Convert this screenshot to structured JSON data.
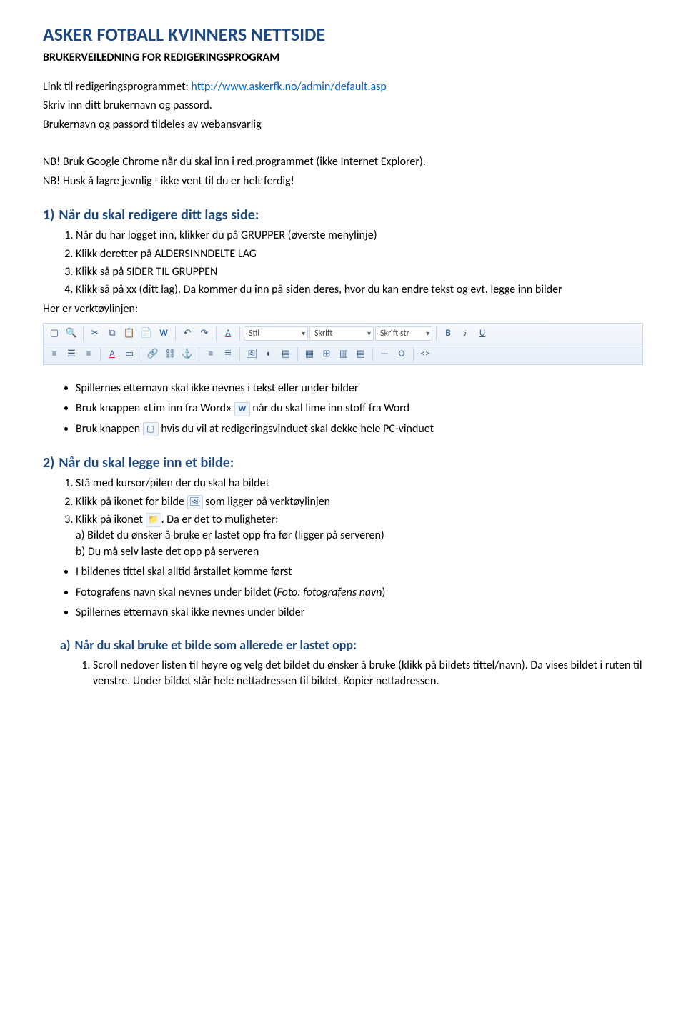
{
  "title": "ASKER FOTBALL KVINNERS NETTSIDE",
  "subtitle": "BRUKERVEILEDNING FOR REDIGERINGSPROGRAM",
  "intro": {
    "line1_prefix": "Link til redigeringsprogrammet: ",
    "link_text": "http://www.askerfk.no/admin/default.asp",
    "line2": "Skriv inn ditt brukernavn og passord.",
    "line3": "Brukernavn og passord tildeles av webansvarlig",
    "nb1": "NB! Bruk Google Chrome når du skal inn i red.programmet (ikke Internet Explorer).",
    "nb2": "NB! Husk å lagre jevnlig - ikke vent til du er helt ferdig!"
  },
  "section1": {
    "num": "1)",
    "title": "Når du skal redigere ditt lags side:",
    "items": [
      "Når du har logget inn, klikker du på GRUPPER (øverste menylinje)",
      "Klikk deretter på ALDERSINNDELTE LAG",
      "Klikk så på SIDER TIL GRUPPEN",
      "Klikk så på xx (ditt lag). Da kommer du inn på siden deres, hvor du kan endre tekst og evt. legge inn bilder"
    ],
    "toolbar_label": "Her er verktøylinjen:"
  },
  "toolbar": {
    "style_dd": "Stil",
    "font_dd": "Skrift",
    "fontsize_dd": "Skrift str"
  },
  "bullets1": {
    "b1": "Spillernes etternavn skal ikke nevnes i tekst eller under bilder",
    "b2_before": "Bruk knappen «Lim inn fra Word» ",
    "b2_after": " når du skal lime inn stoff fra Word",
    "b3_before": "Bruk knappen ",
    "b3_after": " hvis du vil at redigeringsvinduet skal dekke hele PC-vinduet"
  },
  "section2": {
    "num": "2)",
    "title": "Når du skal legge inn et bilde:",
    "i1": "Stå med kursor/pilen der du skal ha bildet",
    "i2_before": "Klikk på ikonet for bilde ",
    "i2_after": " som ligger på verktøylinjen",
    "i3_before": "Klikk på ikonet ",
    "i3_after": ". Da er det to muligheter:",
    "i3a": "a) Bildet du ønsker å bruke er lastet opp fra før (ligger på serveren)",
    "i3b": "b) Du må selv laste det opp på serveren"
  },
  "bullets2": {
    "b1_before": "I bildenes tittel skal ",
    "b1_underline": "alltid",
    "b1_after": " årstallet komme først",
    "b2_before": "Fotografens navn skal nevnes under bildet (",
    "b2_italic": "Foto: fotografens navn",
    "b2_after": ")",
    "b3": "Spillernes etternavn skal ikke nevnes under bilder"
  },
  "subsection_a": {
    "letter": "a)",
    "title": "Når du skal bruke et bilde som allerede er lastet opp:",
    "i1": "Scroll nedover listen til høyre og velg det bildet du ønsker å bruke (klikk på bildets tittel/navn). Da vises bildet i ruten til venstre. Under bildet står hele nettadressen til bildet. Kopier nettadressen."
  }
}
